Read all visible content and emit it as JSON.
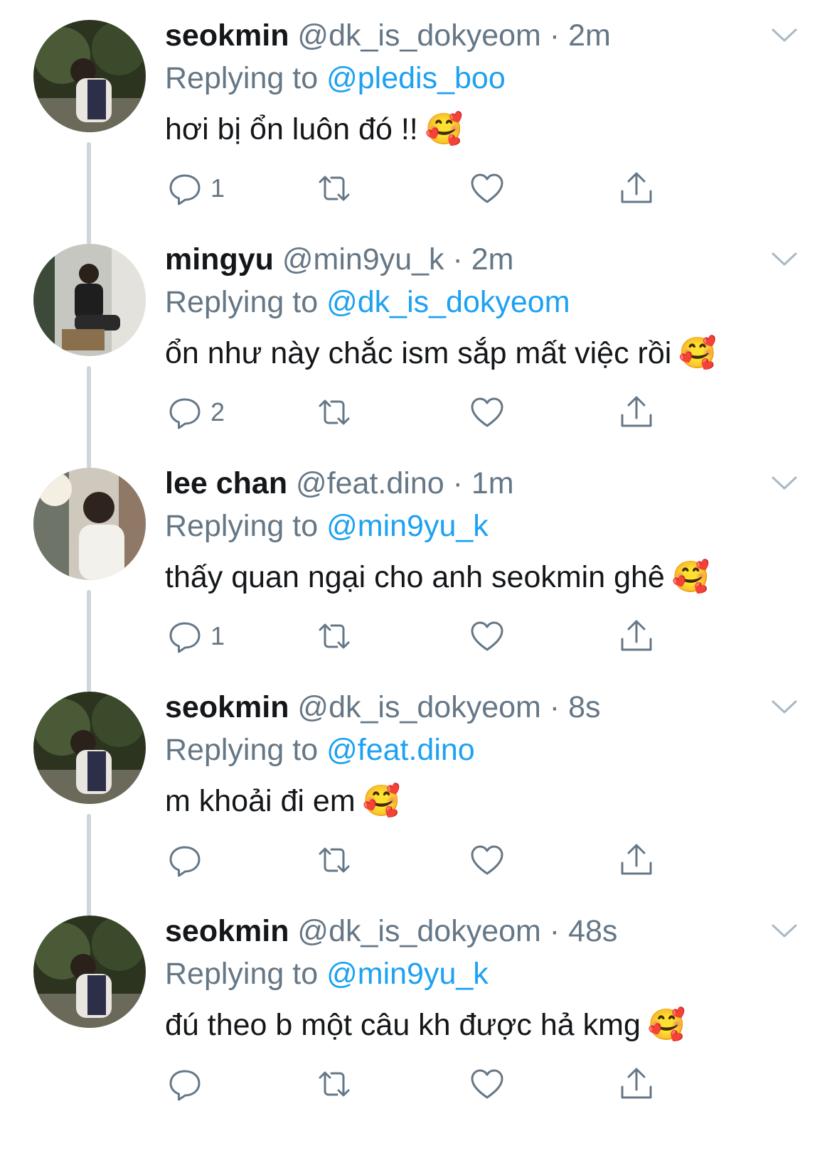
{
  "tweets": [
    {
      "name": "seokmin",
      "handle": "@dk_is_dokyeom",
      "time": "2m",
      "replying_label": "Replying to",
      "replying_to": "@pledis_boo",
      "text": "hơi bị ổn luôn đó !!",
      "emoji": "🥰",
      "reply_count": "1",
      "avatar": "seokmin"
    },
    {
      "name": "mingyu",
      "handle": "@min9yu_k",
      "time": "2m",
      "replying_label": "Replying to",
      "replying_to": "@dk_is_dokyeom",
      "text": "ổn như này chắc ism sắp mất việc rồi",
      "emoji": "🥰",
      "reply_count": "2",
      "avatar": "mingyu"
    },
    {
      "name": "lee chan",
      "handle": "@feat.dino",
      "time": "1m",
      "replying_label": "Replying to",
      "replying_to": "@min9yu_k",
      "text": "thấy quan ngại cho anh seokmin ghê",
      "emoji": "🥰",
      "reply_count": "1",
      "avatar": "leechan"
    },
    {
      "name": "seokmin",
      "handle": "@dk_is_dokyeom",
      "time": "8s",
      "replying_label": "Replying to",
      "replying_to": "@feat.dino",
      "text": "m khoải đi em",
      "emoji": "🥰",
      "reply_count": "",
      "avatar": "seokmin"
    },
    {
      "name": "seokmin",
      "handle": "@dk_is_dokyeom",
      "time": "48s",
      "replying_label": "Replying to",
      "replying_to": "@min9yu_k",
      "text": "đú theo b một câu kh được hả kmg",
      "emoji": "🥰",
      "reply_count": "",
      "avatar": "seokmin"
    }
  ],
  "icons": {
    "reply": "speech-bubble-icon",
    "retweet": "retweet-icon",
    "like": "heart-icon",
    "share": "share-upload-icon",
    "menu": "chevron-down-icon"
  },
  "colors": {
    "accent": "#1da1f2",
    "secondary_text": "#657786",
    "primary_text": "#14171a",
    "thread_line": "#ccd6dd"
  }
}
